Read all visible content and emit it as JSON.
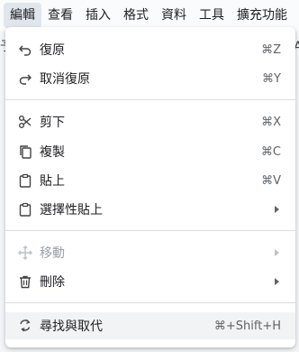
{
  "menubar": {
    "items": [
      {
        "label": "編輯",
        "active": true
      },
      {
        "label": "查看"
      },
      {
        "label": "插入"
      },
      {
        "label": "格式"
      },
      {
        "label": "資料"
      },
      {
        "label": "工具"
      },
      {
        "label": "擴充功能"
      }
    ]
  },
  "background": {
    "left_glyph": "予",
    "right_glyph": "A"
  },
  "menu": {
    "undo": {
      "label": "復原",
      "shortcut": "⌘Z",
      "icon": "undo-icon"
    },
    "redo": {
      "label": "取消復原",
      "shortcut": "⌘Y",
      "icon": "redo-icon"
    },
    "cut": {
      "label": "剪下",
      "shortcut": "⌘X",
      "icon": "scissors-icon"
    },
    "copy": {
      "label": "複製",
      "shortcut": "⌘C",
      "icon": "copy-icon"
    },
    "paste": {
      "label": "貼上",
      "shortcut": "⌘V",
      "icon": "clipboard-icon"
    },
    "paste_special": {
      "label": "選擇性貼上",
      "icon": "clipboard-icon",
      "has_submenu": true
    },
    "move": {
      "label": "移動",
      "icon": "move-icon",
      "has_submenu": true,
      "disabled": true
    },
    "delete": {
      "label": "刪除",
      "icon": "trash-icon",
      "has_submenu": true
    },
    "find_replace": {
      "label": "尋找與取代",
      "shortcut": "⌘+Shift+H",
      "icon": "find-replace-icon"
    }
  },
  "colors": {
    "menubar_bg": "#f9fbfd",
    "active_menu_bg": "#e1e6ed",
    "text": "#202124",
    "shortcut": "#5f6368",
    "disabled": "#9aa0a6",
    "hover_bg": "#f1f3f4",
    "divider": "#dadce0"
  }
}
